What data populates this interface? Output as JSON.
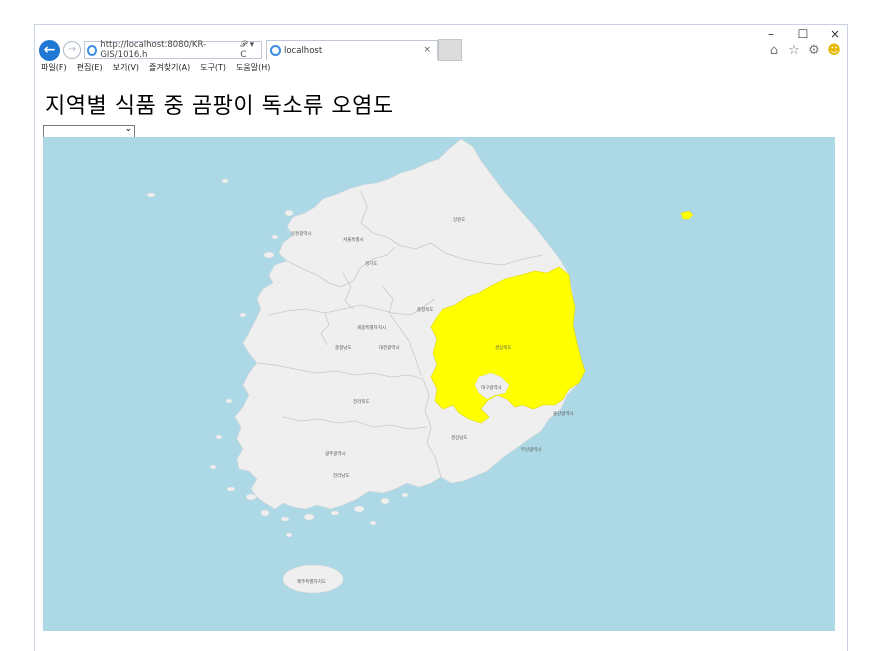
{
  "browser": {
    "address_url": "http://localhost:8080/KR-GIS/1016.h",
    "tab_title": "localhost",
    "tab_close": "×",
    "back_glyph": "←",
    "forward_glyph": "→",
    "addr_tools": "𝒫 ▾ C",
    "window_controls": {
      "minimize": "–",
      "maximize": "☐",
      "close": "×"
    },
    "toolbar_icons": [
      "home-icon",
      "favorites-star-icon",
      "settings-gear-icon",
      "smiley-feedback-icon"
    ]
  },
  "menubar": {
    "items": [
      "파일(F)",
      "편집(E)",
      "보기(V)",
      "즐겨찾기(A)",
      "도구(T)",
      "도움말(H)"
    ]
  },
  "page": {
    "title": "지역별 식품 중 곰팡이 독소류 오염도",
    "select_value": ""
  },
  "map": {
    "colors": {
      "sea": "#add8e6",
      "land": "#efefef",
      "border": "#ffffff",
      "highlight": "#ffff00",
      "label": "#555555"
    },
    "highlighted_region": "경상북도",
    "regions": [
      {
        "name": "강원도"
      },
      {
        "name": "서울특별시"
      },
      {
        "name": "인천광역시"
      },
      {
        "name": "경기도"
      },
      {
        "name": "충청북도"
      },
      {
        "name": "세종특별자치시"
      },
      {
        "name": "충청남도"
      },
      {
        "name": "대전광역시"
      },
      {
        "name": "경상북도"
      },
      {
        "name": "대구광역시"
      },
      {
        "name": "전라북도"
      },
      {
        "name": "울산광역시"
      },
      {
        "name": "경상남도"
      },
      {
        "name": "부산광역시"
      },
      {
        "name": "광주광역시"
      },
      {
        "name": "전라남도"
      },
      {
        "name": "제주특별자치도"
      }
    ]
  }
}
